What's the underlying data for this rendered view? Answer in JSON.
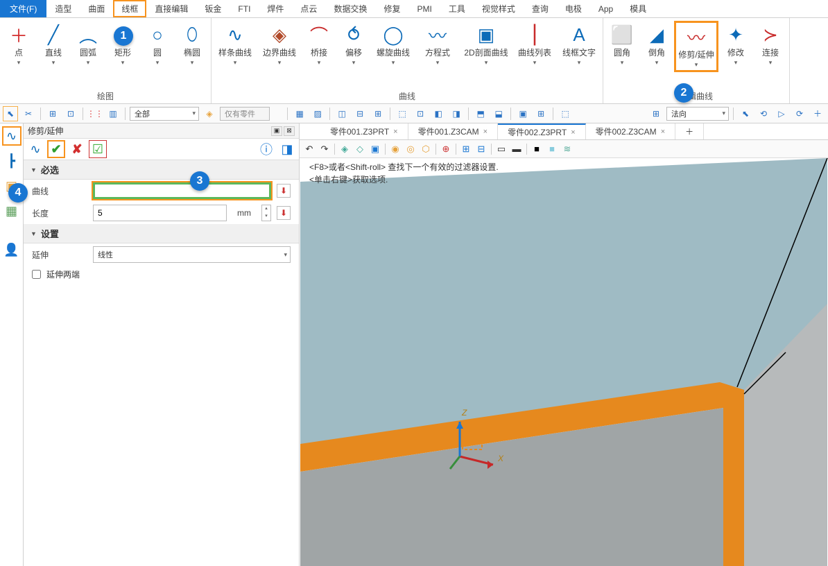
{
  "menu": {
    "file": "文件(F)",
    "items": [
      "造型",
      "曲面",
      "线框",
      "直接编辑",
      "钣金",
      "FTI",
      "焊件",
      "点云",
      "数据交换",
      "修复",
      "PMI",
      "工具",
      "视觉样式",
      "查询",
      "电极",
      "App",
      "模具"
    ],
    "hl_index": 2
  },
  "ribbon": {
    "groups": [
      {
        "title": "绘图",
        "items": [
          {
            "label": "点",
            "icon": "＋",
            "color": "#d32f2f"
          },
          {
            "label": "直线",
            "icon": "╱",
            "color": "#0d6bb8"
          },
          {
            "label": "圆弧",
            "icon": "︵",
            "color": "#0d6bb8"
          },
          {
            "label": "矩形",
            "icon": "▭",
            "color": "#0d6bb8"
          },
          {
            "label": "圆",
            "icon": "○",
            "color": "#0d6bb8"
          },
          {
            "label": "椭圆",
            "icon": "⬯",
            "color": "#0d6bb8"
          }
        ]
      },
      {
        "title": "曲线",
        "items": [
          {
            "label": "样条曲线",
            "icon": "∿",
            "color": "#0d6bb8",
            "wide": true
          },
          {
            "label": "边界曲线",
            "icon": "◈",
            "color": "#b14a2a",
            "wide": true
          },
          {
            "label": "桥接",
            "icon": "⌒",
            "color": "#c82a2a"
          },
          {
            "label": "偏移",
            "icon": "⥀",
            "color": "#0d6bb8"
          },
          {
            "label": "螺旋曲线",
            "icon": "◯",
            "color": "#0d6bb8",
            "wide": true
          },
          {
            "label": "方程式",
            "icon": "〰",
            "color": "#0d6bb8",
            "wide": true
          },
          {
            "label": "2D剖面曲线",
            "icon": "▣",
            "color": "#0d6bb8",
            "xwide": true
          },
          {
            "label": "曲线列表",
            "icon": "⎮",
            "color": "#c82a2a",
            "wide": true
          },
          {
            "label": "线框文字",
            "icon": "A",
            "color": "#0d6bb8",
            "wide": true
          }
        ]
      },
      {
        "title": "编辑曲线",
        "items": [
          {
            "label": "圆角",
            "icon": "⬜",
            "color": "#0d6bb8"
          },
          {
            "label": "倒角",
            "icon": "◢",
            "color": "#0d6bb8"
          },
          {
            "label": "修剪/延伸",
            "icon": "〰",
            "color": "#c82a2a",
            "hl": true,
            "wide": true
          },
          {
            "label": "修改",
            "icon": "✦",
            "color": "#0d6bb8"
          },
          {
            "label": "连接",
            "icon": "≻",
            "color": "#c82a2a"
          }
        ]
      }
    ]
  },
  "qat": {
    "combo1": "全部",
    "text1": "仅有零件",
    "combo2": "法向"
  },
  "tabs": [
    {
      "label": "零件001.Z3PRT",
      "active": false
    },
    {
      "label": "零件001.Z3CAM",
      "active": false
    },
    {
      "label": "零件002.Z3PRT",
      "active": true
    },
    {
      "label": "零件002.Z3CAM",
      "active": false
    }
  ],
  "panel": {
    "title": "修剪/延伸",
    "section1": "必选",
    "curve_label": "曲线",
    "curve_value": "",
    "length_label": "长度",
    "length_value": "5",
    "length_unit": "mm",
    "section2": "设置",
    "extend_label": "延伸",
    "extend_value": "线性",
    "both_ends": "延伸两端"
  },
  "hints": {
    "line1": "<F8>或者<Shift-roll> 查找下一个有效的过滤器设置.",
    "line2": "<单击右键>获取选项."
  },
  "axis": {
    "x": "X",
    "z": "Z"
  }
}
